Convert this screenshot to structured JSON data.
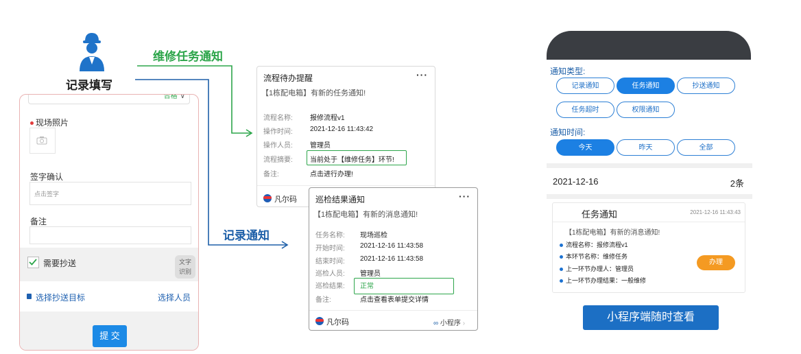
{
  "worker": {
    "label": "记录填写"
  },
  "arrows": {
    "task_label": "维修任务通知",
    "record_label": "记录通知"
  },
  "form": {
    "status_value": "合格",
    "photo_label": "现场照片",
    "signature_label": "签字确认",
    "signature_placeholder": "点击签字",
    "note_label": "备注",
    "cc_checkbox_label": "需要抄送",
    "ocr_button_line1": "文字",
    "ocr_button_line2": "识别",
    "cc_target_label": "选择抄送目标",
    "select_people_link": "选择人员",
    "submit_label": "提 交"
  },
  "card1": {
    "title": "流程待办提醒",
    "subtitle": "【1栋配电箱】有新的任务通知!",
    "rows": [
      {
        "label": "流程名称:",
        "value": "报修流程v1"
      },
      {
        "label": "操作时间:",
        "value": "2021-12-16 11:43:42"
      },
      {
        "label": "操作人员:",
        "value": "管理员"
      },
      {
        "label": "流程摘要:",
        "value": "当前处于【维修任务】环节!"
      },
      {
        "label": "备注:",
        "value": "点击进行办理!"
      }
    ],
    "brand": "凡尔码"
  },
  "card2": {
    "title": "巡检结果通知",
    "subtitle": "【1栋配电箱】有新的消息通知!",
    "rows": [
      {
        "label": "任务名称:",
        "value": "现场巡检"
      },
      {
        "label": "开始时间:",
        "value": "2021-12-16 11:43:58"
      },
      {
        "label": "结束时间:",
        "value": "2021-12-16 11:43:58"
      },
      {
        "label": "巡检人员:",
        "value": "管理员"
      },
      {
        "label": "巡检结果:",
        "value": "正常"
      },
      {
        "label": "备注:",
        "value": "点击查看表单提交详情"
      }
    ],
    "brand": "凡尔码",
    "mini_program": "小程序"
  },
  "phone": {
    "type_label": "通知类型:",
    "type_pills": [
      "记录通知",
      "任务通知",
      "抄送通知",
      "任务超时",
      "权限通知"
    ],
    "active_type": "任务通知",
    "time_label": "通知时间:",
    "time_pills": [
      "今天",
      "昨天",
      "全部"
    ],
    "active_time": "今天",
    "date": "2021-12-16",
    "count": "2条",
    "card": {
      "title": "任务通知",
      "time": "2021-12-16 11:43:43",
      "subtitle": "【1栋配电箱】有新的消息通知!",
      "items": [
        "流程名称：报修流程v1",
        "本环节名称：维修任务",
        "上一环节办理人：管理员",
        "上一环节办理结果：一般维修"
      ],
      "action_label": "办理"
    }
  },
  "banner": {
    "label": "小程序端随时查看"
  },
  "colors": {
    "green": "#2ca54a",
    "blue": "#1d5fa8",
    "accent": "#1c80e3",
    "orange": "#f49a22"
  }
}
